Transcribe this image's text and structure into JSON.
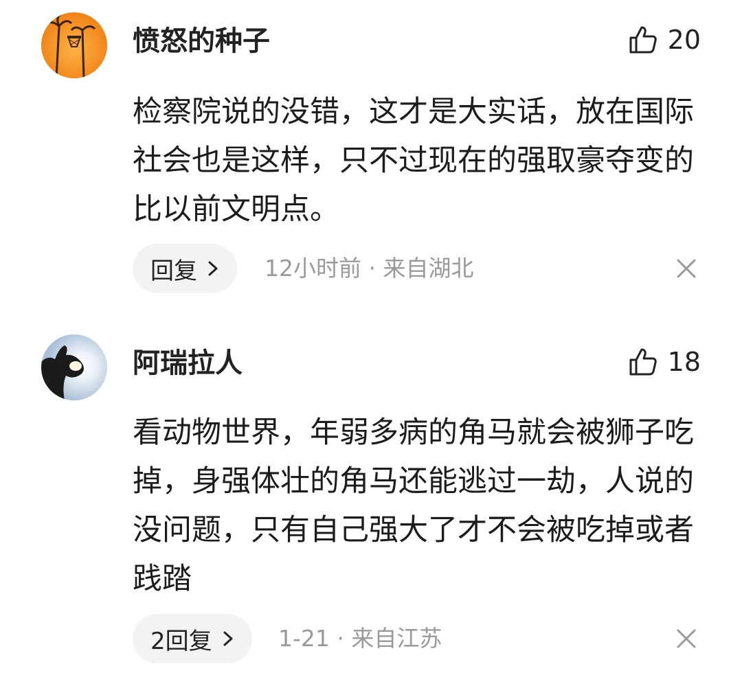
{
  "comments": [
    {
      "username": "愤怒的种子",
      "avatar_icon": "basketball-hoop-sunset-avatar",
      "like_icon": "thumbs-up-icon",
      "likes": "20",
      "content": "检察院说的没错，这才是大实话，放在国际社会也是这样，只不过现在的强取豪夺变的比以前文明点。",
      "reply_label": "回复",
      "time": "12小时前",
      "location": "来自湖北",
      "meta": "12小时前 · 来自湖北",
      "close_icon": "close-icon"
    },
    {
      "username": "阿瑞拉人",
      "avatar_icon": "hand-ok-sun-avatar",
      "like_icon": "thumbs-up-icon",
      "likes": "18",
      "content": "看动物世界，年弱多病的角马就会被狮子吃掉，身强体壮的角马还能逃过一劫，人说的没问题，只有自己强大了才不会被吃掉或者践踏",
      "reply_label": "2回复",
      "time": "1-21",
      "location": "来自江苏",
      "meta": "1-21 · 来自江苏",
      "close_icon": "close-icon"
    }
  ],
  "colors": {
    "text_primary": "#1c1c1c",
    "text_secondary": "#9a9a9a",
    "reply_bg": "#f3f3f3",
    "avatar1_bg": "#f08a1e",
    "avatar2_bg": "#c9d8ea"
  }
}
